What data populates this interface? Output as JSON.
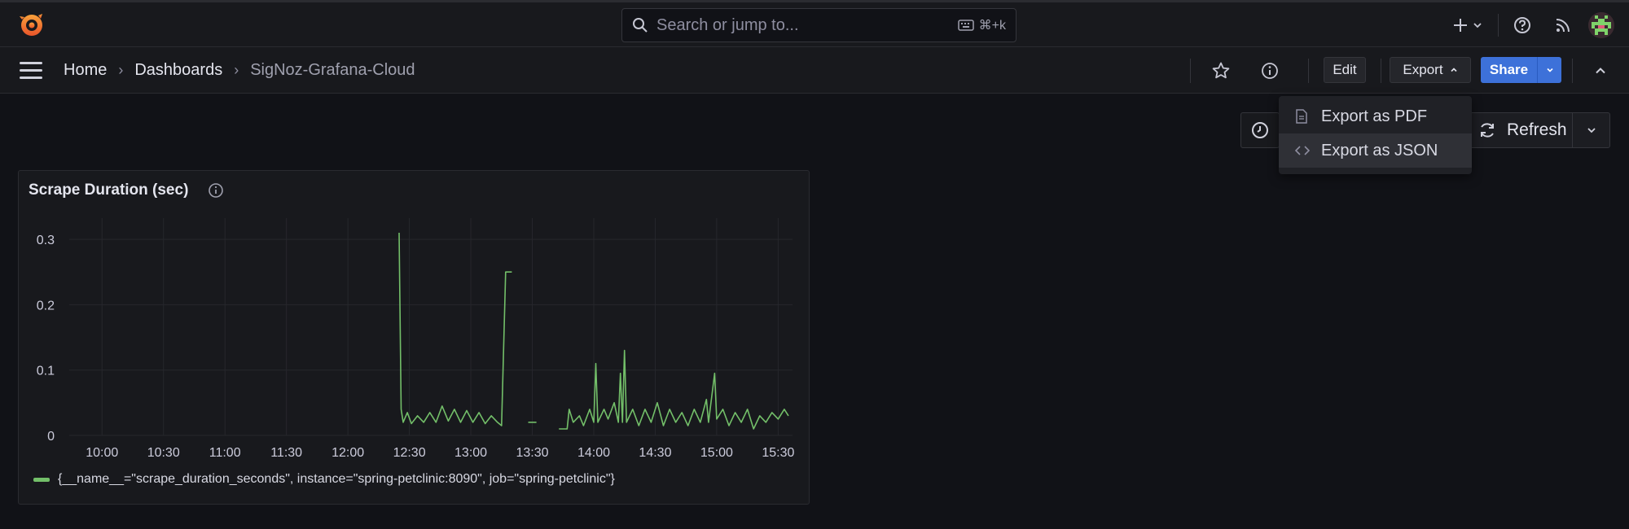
{
  "topbar": {
    "search_placeholder": "Search or jump to...",
    "search_shortcut": "⌘+k",
    "icons": [
      "grafana-logo-icon",
      "search-icon",
      "keyboard-icon",
      "plus-icon",
      "chevron-down-icon",
      "help-icon",
      "rss-icon",
      "avatar"
    ]
  },
  "navbar": {
    "breadcrumbs": [
      "Home",
      "Dashboards",
      "SigNoz-Grafana-Cloud"
    ],
    "edit_label": "Edit",
    "export_label": "Export",
    "share_label": "Share"
  },
  "toolbar": {
    "refresh_label": "Refresh"
  },
  "export_menu": {
    "items": [
      {
        "label": "Export as PDF",
        "icon": "file-icon"
      },
      {
        "label": "Export as JSON",
        "icon": "code-icon"
      }
    ],
    "active_index": 1
  },
  "panel": {
    "title": "Scrape Duration (sec)",
    "legend": "{__name__=\"scrape_duration_seconds\", instance=\"spring-petclinic:8090\", job=\"spring-petclinic\"}"
  },
  "colors": {
    "series": "#73bf69",
    "accent": "#3d71d9",
    "background": "#111217",
    "panel": "#18191d"
  },
  "chart_data": {
    "type": "line",
    "title": "Scrape Duration (sec)",
    "xlabel": "",
    "ylabel": "",
    "x_ticks": [
      "10:00",
      "10:30",
      "11:00",
      "11:30",
      "12:00",
      "12:30",
      "13:00",
      "13:30",
      "14:00",
      "14:30",
      "15:00",
      "15:30"
    ],
    "y_ticks": [
      "0",
      "0.1",
      "0.2",
      "0.3"
    ],
    "ylim": [
      0,
      0.32
    ],
    "xlim": [
      "09:44",
      "15:37"
    ],
    "grid": true,
    "legend_position": "bottom-left",
    "series": [
      {
        "name": "{__name__=\"scrape_duration_seconds\", instance=\"spring-petclinic:8090\", job=\"spring-petclinic\"}",
        "segments": [
          [
            [
              "12:25",
              0.31
            ],
            [
              "12:26",
              0.04
            ],
            [
              "12:27",
              0.02
            ],
            [
              "12:29",
              0.035
            ],
            [
              "12:31",
              0.018
            ],
            [
              "12:34",
              0.03
            ],
            [
              "12:37",
              0.02
            ],
            [
              "12:40",
              0.035
            ],
            [
              "12:43",
              0.02
            ],
            [
              "12:46",
              0.045
            ],
            [
              "12:49",
              0.022
            ],
            [
              "12:52",
              0.04
            ],
            [
              "12:55",
              0.02
            ],
            [
              "12:58",
              0.038
            ],
            [
              "13:01",
              0.02
            ],
            [
              "13:04",
              0.035
            ],
            [
              "13:07",
              0.018
            ],
            [
              "13:10",
              0.03
            ],
            [
              "13:13",
              0.02
            ],
            [
              "13:15",
              0.015
            ],
            [
              "13:17",
              0.25
            ],
            [
              "13:20",
              0.25
            ]
          ],
          [
            [
              "13:28",
              0.02
            ],
            [
              "13:32",
              0.02
            ]
          ],
          [
            [
              "13:43",
              0.01
            ],
            [
              "13:47",
              0.01
            ],
            [
              "13:48",
              0.04
            ],
            [
              "13:50",
              0.02
            ],
            [
              "13:53",
              0.03
            ],
            [
              "13:55",
              0.015
            ],
            [
              "13:58",
              0.04
            ],
            [
              "14:00",
              0.02
            ],
            [
              "14:01",
              0.11
            ],
            [
              "14:02",
              0.02
            ],
            [
              "14:05",
              0.04
            ],
            [
              "14:07",
              0.025
            ],
            [
              "14:10",
              0.05
            ],
            [
              "14:12",
              0.02
            ],
            [
              "14:13",
              0.095
            ],
            [
              "14:14",
              0.02
            ],
            [
              "14:15",
              0.13
            ],
            [
              "14:16",
              0.02
            ],
            [
              "14:19",
              0.04
            ],
            [
              "14:22",
              0.015
            ],
            [
              "14:25",
              0.04
            ],
            [
              "14:28",
              0.02
            ],
            [
              "14:31",
              0.05
            ],
            [
              "14:34",
              0.015
            ],
            [
              "14:37",
              0.04
            ],
            [
              "14:40",
              0.02
            ],
            [
              "14:43",
              0.035
            ],
            [
              "14:46",
              0.015
            ],
            [
              "14:49",
              0.04
            ],
            [
              "14:52",
              0.02
            ],
            [
              "14:55",
              0.055
            ],
            [
              "14:56",
              0.02
            ],
            [
              "14:59",
              0.095
            ],
            [
              "15:00",
              0.025
            ],
            [
              "15:03",
              0.04
            ],
            [
              "15:06",
              0.015
            ],
            [
              "15:09",
              0.035
            ],
            [
              "15:12",
              0.02
            ],
            [
              "15:15",
              0.04
            ],
            [
              "15:18",
              0.01
            ],
            [
              "15:21",
              0.03
            ],
            [
              "15:24",
              0.02
            ],
            [
              "15:27",
              0.035
            ],
            [
              "15:30",
              0.025
            ],
            [
              "15:33",
              0.04
            ],
            [
              "15:35",
              0.03
            ]
          ]
        ]
      }
    ]
  }
}
